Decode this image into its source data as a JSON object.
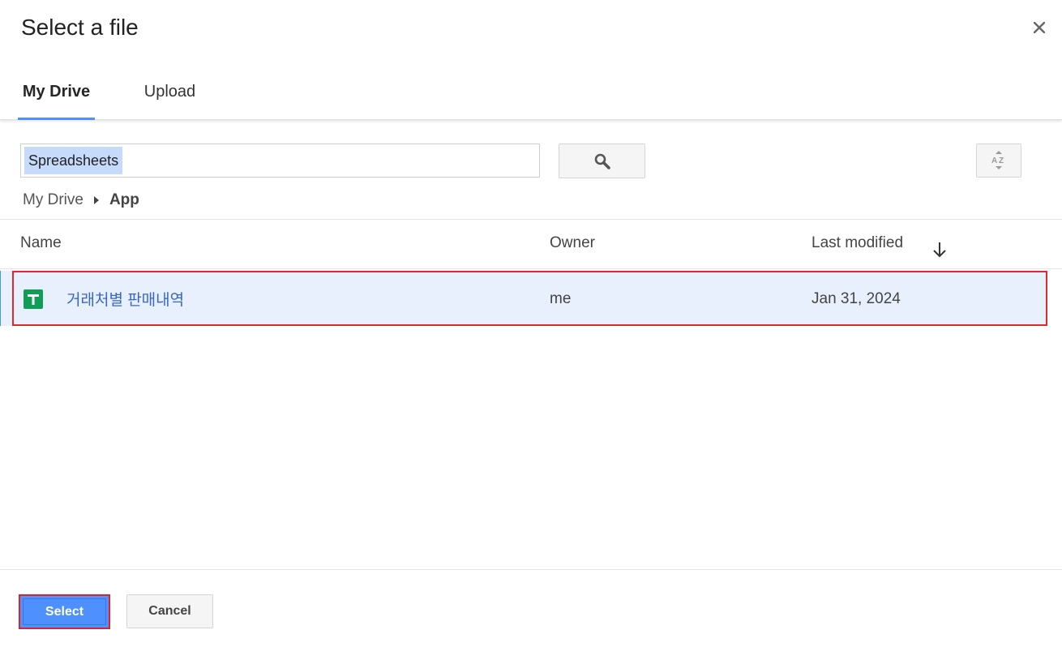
{
  "dialog": {
    "title": "Select a file"
  },
  "tabs": [
    {
      "label": "My Drive",
      "active": true
    },
    {
      "label": "Upload",
      "active": false
    }
  ],
  "search": {
    "value": "Spreadsheets",
    "button_icon": "search-icon"
  },
  "sort_button": {
    "icon": "sort-az-icon"
  },
  "breadcrumb": {
    "root": "My Drive",
    "current": "App"
  },
  "table": {
    "columns": {
      "name": "Name",
      "owner": "Owner",
      "last_modified": "Last modified"
    },
    "sort_direction_icon": "arrow-down-icon",
    "rows": [
      {
        "icon": "google-sheets-icon",
        "name": "거래처별 판매내역",
        "owner": "me",
        "last_modified": "Jan 31, 2024",
        "selected": true
      }
    ]
  },
  "footer": {
    "select_label": "Select",
    "cancel_label": "Cancel"
  },
  "colors": {
    "accent": "#4d90fe",
    "row_selected_bg": "#e8f0fe",
    "highlight_outline": "#e0282e",
    "sheets_green": "#0f9d58"
  }
}
